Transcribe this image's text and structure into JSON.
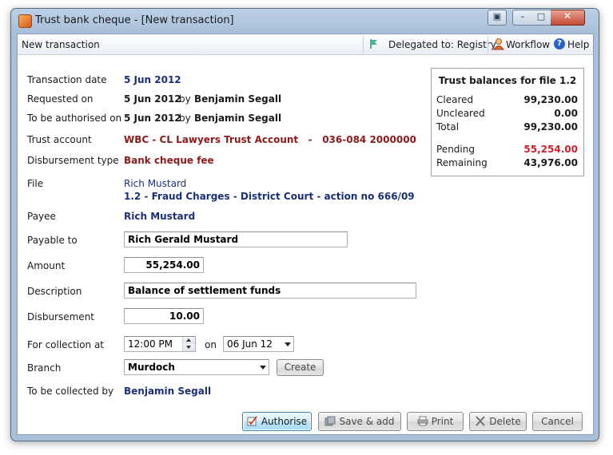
{
  "window": {
    "title": "Trust bank cheque - [New transaction]"
  },
  "toolbar": {
    "title": "New transaction",
    "delegated": "Delegated to: Registry",
    "workflow": "Workflow",
    "help": "Help"
  },
  "form": {
    "transaction_date": {
      "label": "Transaction date",
      "value": "5 Jun 2012"
    },
    "requested_on": {
      "label": "Requested on",
      "date": "5 Jun 2012",
      "by": "by",
      "name": "Benjamin Segall"
    },
    "to_be_authorised_on": {
      "label": "To be authorised on",
      "date": "5 Jun 2012",
      "by": "by",
      "name": "Benjamin Segall"
    },
    "trust_account": {
      "label": "Trust account",
      "value": "WBC - CL Lawyers Trust Account   -   036-084 2000000"
    },
    "disbursement_type": {
      "label": "Disbursement type",
      "value": "Bank cheque fee"
    },
    "file": {
      "label": "File",
      "client": "Rich Mustard",
      "matter": "1.2 - Fraud Charges - District Court - action no 666/09"
    },
    "payee": {
      "label": "Payee",
      "value": "Rich Mustard"
    },
    "payable_to": {
      "label": "Payable to",
      "value": "Rich Gerald Mustard"
    },
    "amount": {
      "label": "Amount",
      "value": "55,254.00"
    },
    "description": {
      "label": "Description",
      "value": "Balance of settlement funds"
    },
    "disbursement": {
      "label": "Disbursement",
      "value": "10.00"
    },
    "for_collection_at": {
      "label": "For collection at",
      "time": "12:00 PM",
      "on": "on",
      "date": "06 Jun 12"
    },
    "branch": {
      "label": "Branch",
      "value": "Murdoch",
      "create": "Create"
    },
    "collected_by": {
      "label": "To be collected by",
      "value": "Benjamin Segall"
    }
  },
  "balances": {
    "title": "Trust balances for file 1.2",
    "cleared": {
      "label": "Cleared",
      "value": "99,230.00"
    },
    "uncleared": {
      "label": "Uncleared",
      "value": "0.00"
    },
    "total": {
      "label": "Total",
      "value": "99,230.00"
    },
    "pending": {
      "label": "Pending",
      "value": "55,254.00"
    },
    "remaining": {
      "label": "Remaining",
      "value": "43,976.00"
    }
  },
  "buttons": {
    "authorise": "Authorise",
    "save_add": "Save & add",
    "print": "Print",
    "delete": "Delete",
    "cancel": "Cancel"
  },
  "colors": {
    "value_blue": "#1a2f7a",
    "account_red": "#8b1a1a",
    "pending_red": "#d0202a",
    "window_frame": "#a9c0da"
  }
}
